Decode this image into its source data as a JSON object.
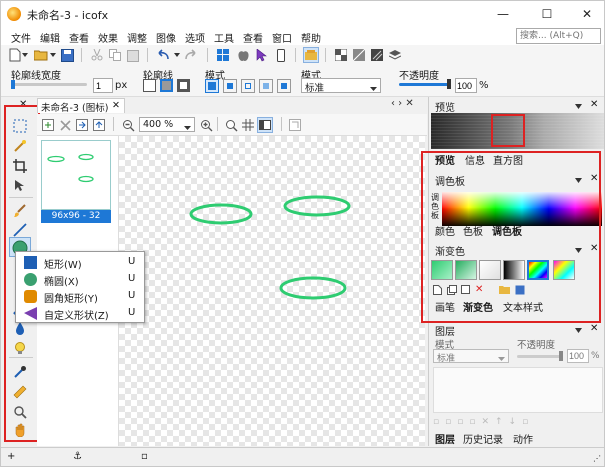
{
  "window": {
    "title": "未命名-3 - icofx",
    "minimize": "—",
    "maximize": "☐",
    "close": "✕"
  },
  "menu": [
    "文件",
    "编辑",
    "查看",
    "效果",
    "调整",
    "图像",
    "选项",
    "工具",
    "查看",
    "窗口",
    "帮助"
  ],
  "search": {
    "placeholder": "搜索... (Alt+Q)"
  },
  "toolbar2": {
    "outline_width_label": "轮廓线宽度",
    "outline_width_value": "1",
    "outline_width_unit": "px",
    "outline_label": "轮廓线",
    "mode_label": "模式",
    "blend_label": "模式",
    "blend_value": "标准",
    "opacity_label": "不透明度",
    "opacity_value": "100",
    "opacity_unit": "%"
  },
  "document": {
    "tab_label": "未命名-3 (图标)",
    "tab_close": "✕",
    "nav": "‹ › ✕",
    "zoom": "400 %",
    "thumb_label": "96x96 - 32"
  },
  "flyout": [
    {
      "label": "矩形(W)",
      "key": "U",
      "color": "#1e5fb4"
    },
    {
      "label": "椭圆(X)",
      "key": "U",
      "color": "#3aa070"
    },
    {
      "label": "圆角矩形(Y)",
      "key": "U",
      "color": "#e08a00"
    },
    {
      "label": "自定义形状(Z)",
      "key": "U",
      "color": "#7a3fb0"
    }
  ],
  "right": {
    "preview_header": "预览",
    "tabs1": [
      "预览",
      "信息",
      "直方图"
    ],
    "palette_header": "调色板",
    "palette_side": "调色板",
    "tabs2": [
      "颜色",
      "色板",
      "调色板"
    ],
    "gradient_header": "渐变色",
    "tabs3": [
      "画笔",
      "渐变色",
      "文本样式"
    ],
    "layers_header": "图层",
    "layers_mode_label": "模式",
    "layers_mode_value": "标准",
    "layers_opacity_label": "不透明度",
    "layers_opacity_value": "100",
    "layers_opacity_unit": "%",
    "tabs4": [
      "图层",
      "历史记录",
      "动作"
    ]
  },
  "colors": {
    "accent": "#1e78d6",
    "highlight": "#d22222",
    "ellipse": "#2ecc71"
  }
}
